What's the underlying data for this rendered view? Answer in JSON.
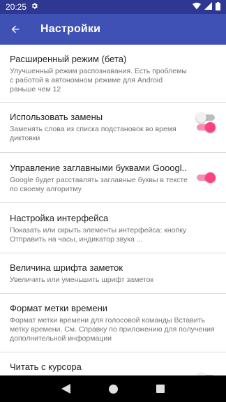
{
  "status_bar": {
    "time": "20:25",
    "icons": [
      "gear-icon",
      "wifi-icon",
      "signal-icon",
      "battery-icon"
    ]
  },
  "app_bar": {
    "title": "Настройки",
    "back_icon": "arrow-back-icon",
    "color": "#3f51b5"
  },
  "settings": [
    {
      "title": "Расширенный режим (бета)",
      "summary": "Улучшенный режим распознавания. Есть проблемы с работой в автономном режиме для Android раньше чем 12",
      "switch": "off"
    },
    {
      "title": "Использовать замены",
      "summary": "Заменять слова из списка подстановок во время диктовки",
      "switch": "on"
    },
    {
      "title": "Управление заглавными буквами Gooogl..",
      "summary": "Google будет расставлять заглавные буквы в тексте по своему алгоритму",
      "switch": "on"
    },
    {
      "title": "Настройка интерфейса",
      "summary": "Показать или скрыть элементы интерфейса: кнопку Отправить на часы, индикатор звука ..."
    },
    {
      "title": "Величина шрифта заметок",
      "summary": "Увеличить или уменьшить шрифт заметок"
    },
    {
      "title": "Формат метки времени",
      "summary": "Формат метки времени для голосовой команды Вставить метку времени. См. Справку по приложению для получения дополнительной информации"
    },
    {
      "title": "Читать с курсора",
      "summary": "",
      "switch": "off"
    }
  ],
  "colors": {
    "accent": "#ff4081",
    "primary": "#3f51b5",
    "primary_dark": "#2e3792"
  },
  "nav_bar": {
    "icons": [
      "back-triangle-icon",
      "home-circle-icon",
      "recents-square-icon"
    ]
  }
}
